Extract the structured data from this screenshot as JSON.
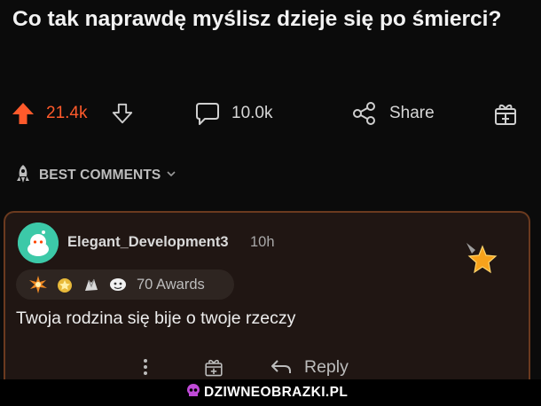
{
  "post": {
    "title": "Co tak naprawdę myślisz dzieje się po śmierci?"
  },
  "actions": {
    "score": "21.4k",
    "comments": "10.0k",
    "share_label": "Share",
    "accent_color": "#ff5a2b",
    "icons": [
      "upvote-arrow",
      "downvote-arrow",
      "comment-bubble",
      "share-nodes",
      "gift-box"
    ]
  },
  "sort": {
    "label": "BEST COMMENTS",
    "icon": "rocket-icon"
  },
  "comment": {
    "username": "Elegant_Development3",
    "time": "10h",
    "awards_label": "70 Awards",
    "award_icons": [
      "burst-award",
      "medal-award",
      "hands-award",
      "bubble-award"
    ],
    "body": "Twoja rodzina się bije o twoje rzeczy",
    "reply_label": "Reply",
    "border_color": "#6b3a1f"
  },
  "footer": {
    "watermark": "DZIWNEOBRAZKI.PL"
  }
}
